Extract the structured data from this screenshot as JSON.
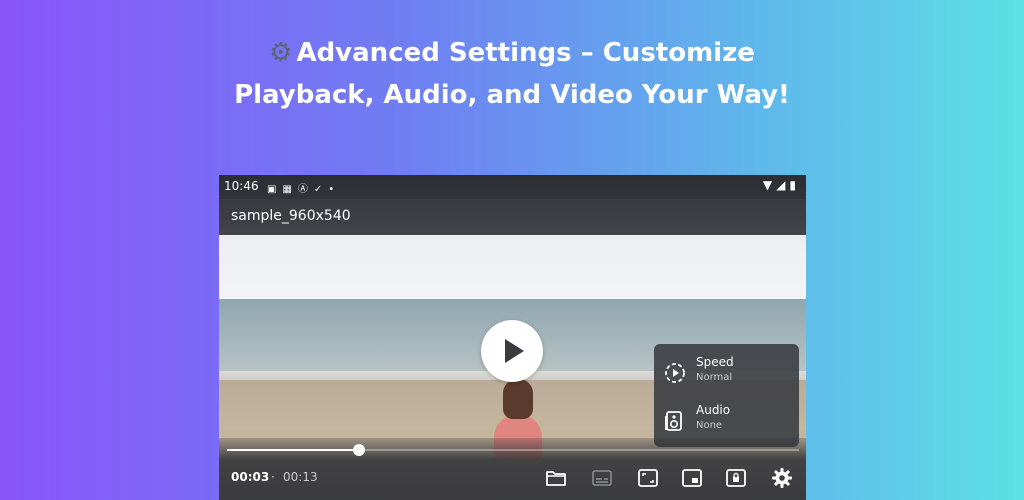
{
  "headline": {
    "icon": "gear-icon",
    "line1": "Advanced Settings – Customize",
    "line2": "Playback, Audio, and Video Your Way!"
  },
  "status_bar": {
    "time": "10:46",
    "left_icons": [
      "image-icon",
      "qr-icon",
      "a-badge-icon",
      "check-icon",
      "dot-icon"
    ],
    "right_icons": [
      "wifi-icon",
      "signal-icon",
      "battery-icon"
    ]
  },
  "player": {
    "title": "sample_960x540",
    "progress": 0.23,
    "current_time": "00:03",
    "separator": "·",
    "total_time": "00:13",
    "accent_color": "#ffffff"
  },
  "settings_menu": {
    "items": [
      {
        "icon": "speed-icon",
        "label": "Speed",
        "value": "Normal"
      },
      {
        "icon": "audio-icon",
        "label": "Audio",
        "value": "None"
      }
    ]
  },
  "controls": [
    "folder-icon",
    "subtitles-icon",
    "aspect-ratio-icon",
    "picture-in-picture-icon",
    "lock-icon",
    "settings-gear-icon"
  ]
}
